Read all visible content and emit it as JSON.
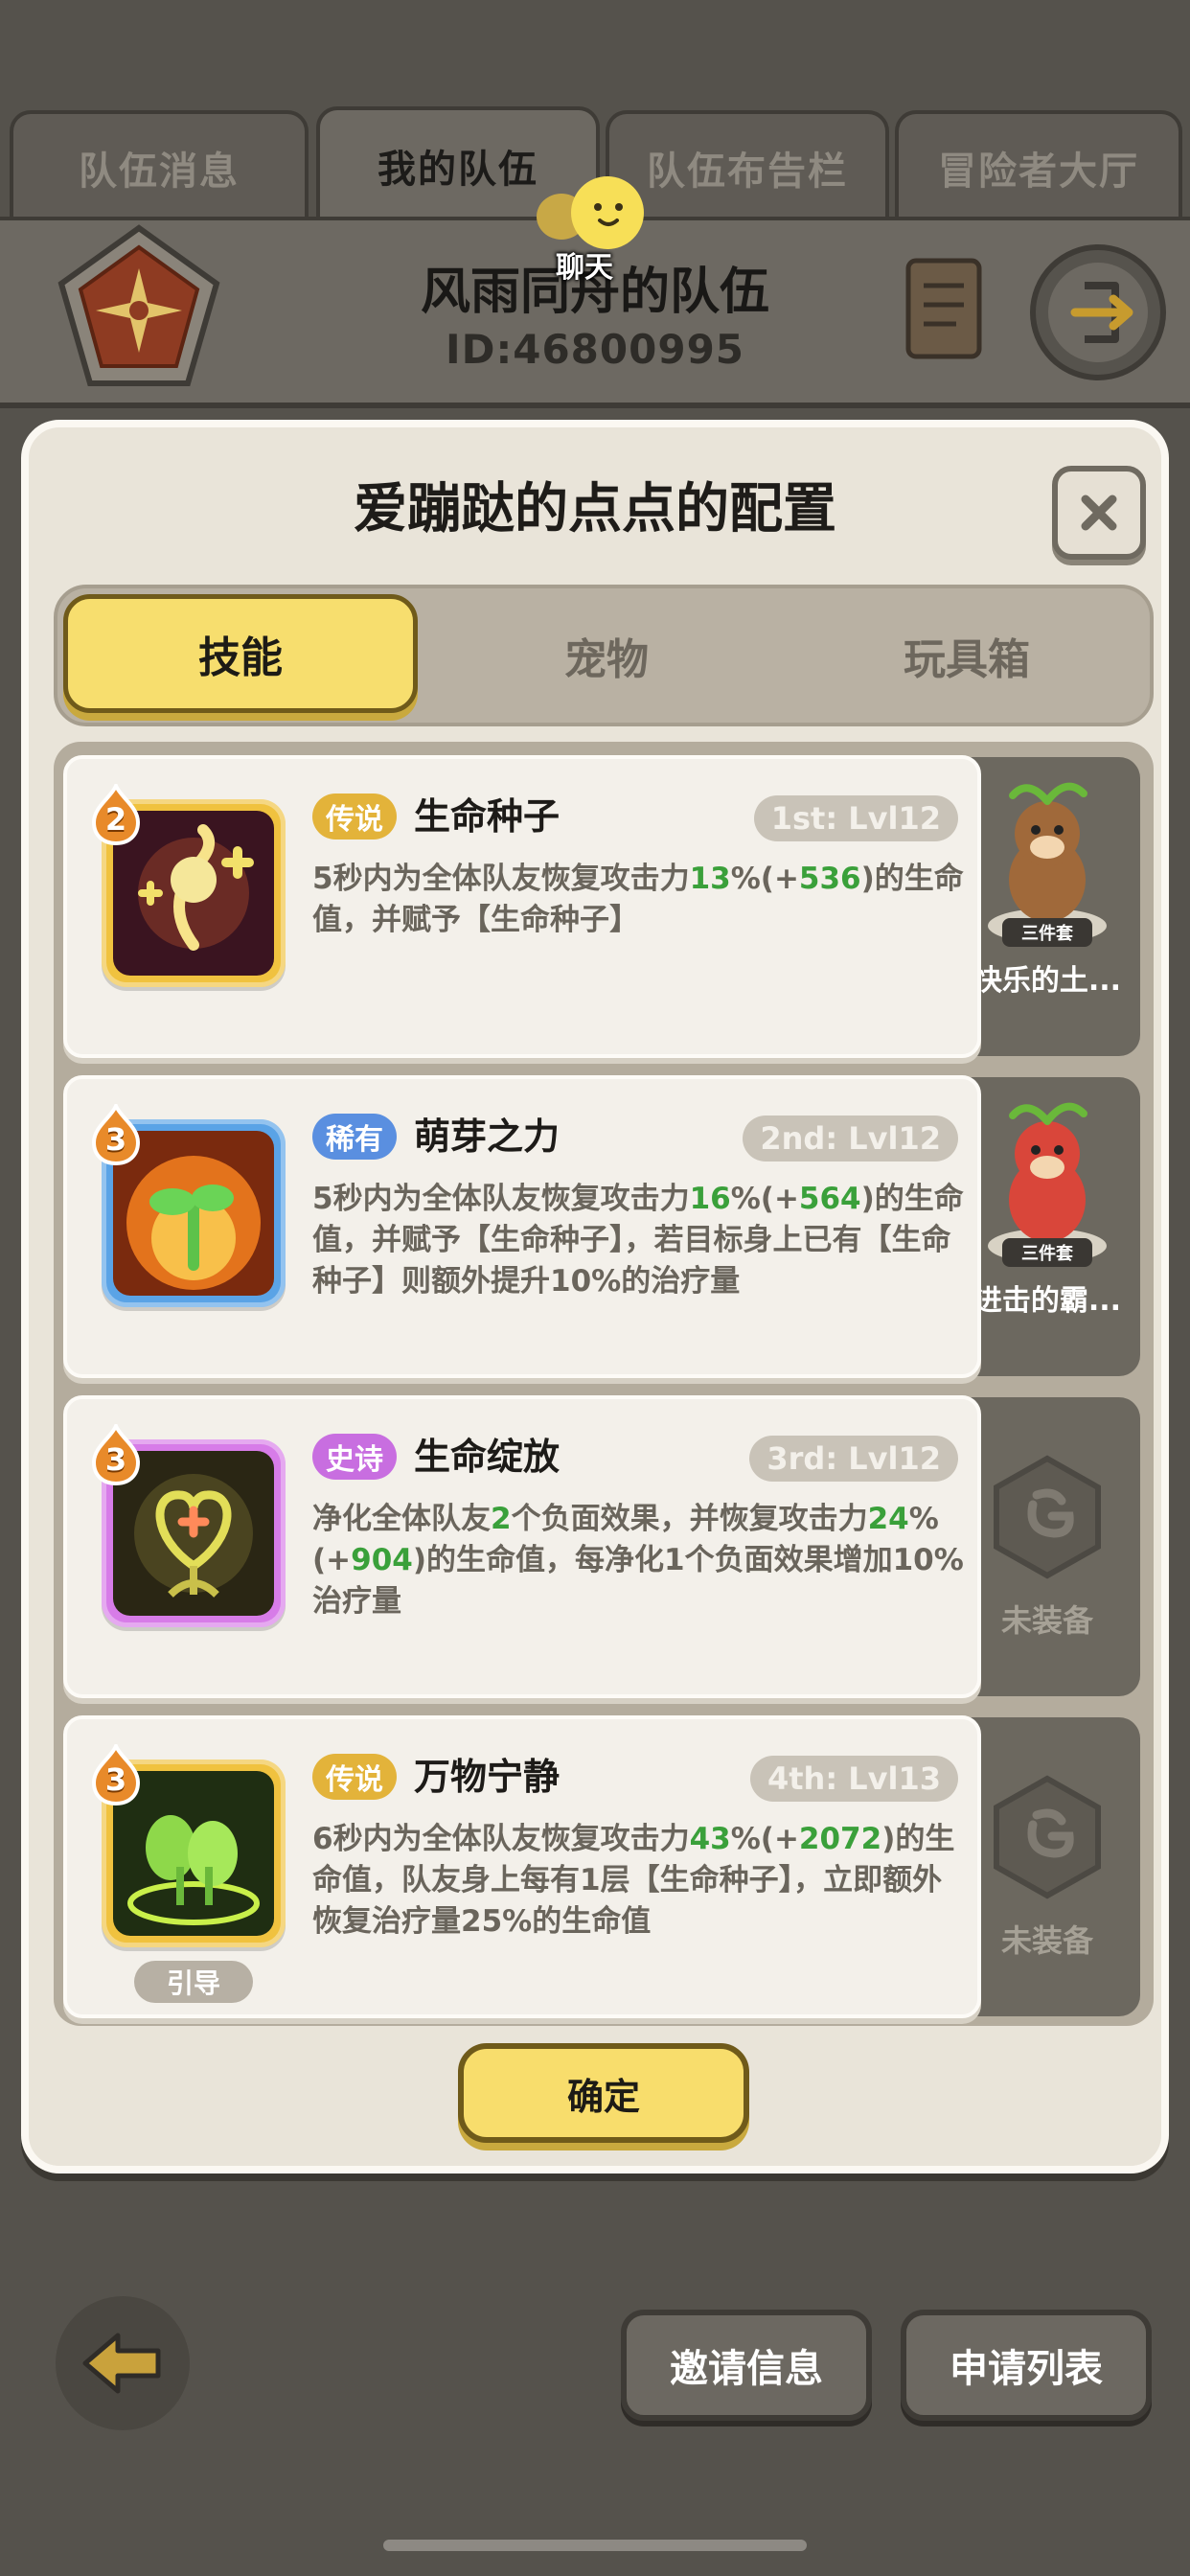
{
  "top_tabs": [
    {
      "label": "队伍消息",
      "active": false
    },
    {
      "label": "我的队伍",
      "active": true
    },
    {
      "label": "队伍布告栏",
      "active": false
    },
    {
      "label": "冒险者大厅",
      "active": false
    }
  ],
  "chat": {
    "label": "聊天"
  },
  "team": {
    "name": "风雨同舟的队伍",
    "id": "ID:46800995"
  },
  "dialog": {
    "title": "爱蹦跶的点点的配置",
    "tabs": [
      {
        "label": "技能",
        "active": true
      },
      {
        "label": "宠物",
        "active": false
      },
      {
        "label": "玩具箱",
        "active": false
      }
    ],
    "skills": [
      {
        "level": "2",
        "rarity": "传说",
        "rarity_color": "#e3b33a",
        "name": "生命种子",
        "slot": "1st: Lvl12",
        "desc_parts": [
          {
            "t": "5秒内为全体队友恢复攻击力",
            "g": false
          },
          {
            "t": "13",
            "g": true
          },
          {
            "t": "%(+",
            "g": false
          },
          {
            "t": "536",
            "g": true
          },
          {
            "t": ")的生命值，并赋予【生命种子】",
            "g": false
          }
        ],
        "icon": "life-seed-icon",
        "frame_color": "#f0c23f",
        "tag": "",
        "pet": {
          "name": "快乐的土...",
          "set_label": "三件套",
          "equipped": true,
          "color": "#a0693a"
        }
      },
      {
        "level": "3",
        "rarity": "稀有",
        "rarity_color": "#5a8fe0",
        "name": "萌芽之力",
        "slot": "2nd: Lvl12",
        "desc_parts": [
          {
            "t": "5秒内为全体队友恢复攻击力",
            "g": false
          },
          {
            "t": "16",
            "g": true
          },
          {
            "t": "%(+",
            "g": false
          },
          {
            "t": "564",
            "g": true
          },
          {
            "t": ")的生命值，并赋予【生命种子】，若目标身上已有【生命种子】则额外提升10%的治疗量",
            "g": false
          }
        ],
        "icon": "sprout-power-icon",
        "frame_color": "#5aa3e6",
        "tag": "",
        "pet": {
          "name": "进击的霸...",
          "set_label": "三件套",
          "equipped": true,
          "color": "#d9463a"
        }
      },
      {
        "level": "3",
        "rarity": "史诗",
        "rarity_color": "#c86ee0",
        "name": "生命绽放",
        "slot": "3rd: Lvl12",
        "desc_parts": [
          {
            "t": "净化全体队友",
            "g": false
          },
          {
            "t": "2",
            "g": true
          },
          {
            "t": "个负面效果，并恢复攻击力",
            "g": false
          },
          {
            "t": "24",
            "g": true
          },
          {
            "t": "%(+",
            "g": false
          },
          {
            "t": "904",
            "g": true
          },
          {
            "t": ")的生命值，每净化1个负面效果增加10%治疗量",
            "g": false
          }
        ],
        "icon": "life-bloom-icon",
        "frame_color": "#d77ce8",
        "tag": "",
        "pet": {
          "name": "未装备",
          "set_label": "",
          "equipped": false,
          "color": ""
        }
      },
      {
        "level": "3",
        "rarity": "传说",
        "rarity_color": "#e3b33a",
        "name": "万物宁静",
        "slot": "4th: Lvl13",
        "desc_parts": [
          {
            "t": "6秒内为全体队友恢复攻击力",
            "g": false
          },
          {
            "t": "43",
            "g": true
          },
          {
            "t": "%(+",
            "g": false
          },
          {
            "t": "2072",
            "g": true
          },
          {
            "t": ")的生命值，队友身上每有1层【生命种子】，立即额外恢复治疗量25%的生命值",
            "g": false
          }
        ],
        "icon": "serenity-icon",
        "frame_color": "#f0c23f",
        "tag": "引导",
        "pet": {
          "name": "未装备",
          "set_label": "",
          "equipped": false,
          "color": ""
        }
      }
    ],
    "confirm_label": "确定"
  },
  "bottom": {
    "invite_label": "邀请信息",
    "apply_label": "申请列表"
  }
}
